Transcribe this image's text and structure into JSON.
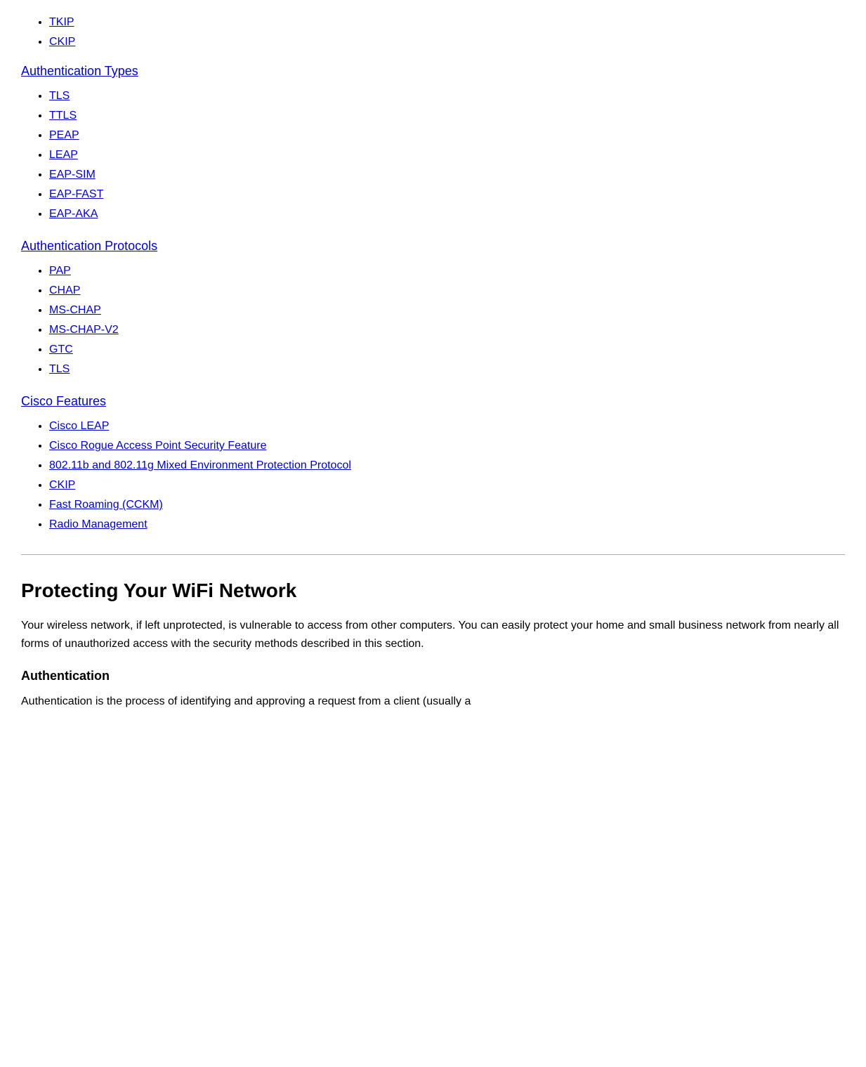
{
  "top_links": {
    "items": [
      {
        "label": "TKIP",
        "href": "#"
      },
      {
        "label": "CKIP",
        "href": "#"
      }
    ]
  },
  "authentication_types": {
    "heading": "Authentication Types",
    "items": [
      {
        "label": "TLS",
        "href": "#"
      },
      {
        "label": "TTLS",
        "href": "#"
      },
      {
        "label": "PEAP",
        "href": "#"
      },
      {
        "label": "LEAP",
        "href": "#"
      },
      {
        "label": "EAP-SIM",
        "href": "#"
      },
      {
        "label": "EAP-FAST",
        "href": "#"
      },
      {
        "label": "EAP-AKA",
        "href": "#"
      }
    ]
  },
  "authentication_protocols": {
    "heading": "Authentication Protocols",
    "items": [
      {
        "label": "PAP",
        "href": "#"
      },
      {
        "label": "CHAP",
        "href": "#"
      },
      {
        "label": "MS-CHAP",
        "href": "#"
      },
      {
        "label": "MS-CHAP-V2",
        "href": "#"
      },
      {
        "label": "GTC",
        "href": "#"
      },
      {
        "label": "TLS",
        "href": "#"
      }
    ]
  },
  "cisco_features": {
    "heading": "Cisco Features",
    "items": [
      {
        "label": "Cisco LEAP",
        "href": "#"
      },
      {
        "label": "Cisco Rogue Access Point Security Feature",
        "href": "#"
      },
      {
        "label": "802.11b and 802.11g Mixed Environment Protection Protocol",
        "href": "#"
      },
      {
        "label": "CKIP",
        "href": "#"
      },
      {
        "label": "Fast Roaming (CCKM)",
        "href": "#"
      },
      {
        "label": "Radio Management",
        "href": "#"
      }
    ]
  },
  "main_section": {
    "title": "Protecting Your WiFi Network",
    "intro": "Your wireless network, if left unprotected, is vulnerable to access from other computers. You can easily protect your home and small business network from nearly all forms of unauthorized access with the security methods described in this section.",
    "auth_heading": "Authentication",
    "auth_body": "Authentication is the process of identifying and approving a request from a client (usually a"
  }
}
